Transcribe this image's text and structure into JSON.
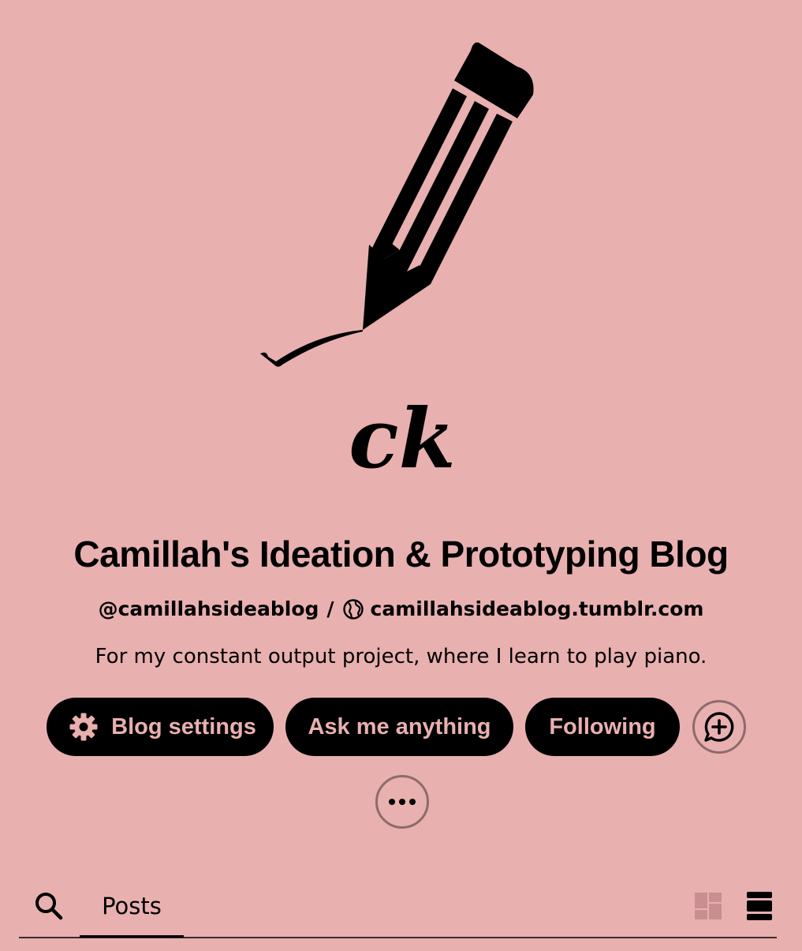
{
  "blog": {
    "title": "Camillah's Ideation & Prototyping Blog",
    "handle": "@camillahsideablog",
    "separator": "/",
    "url": "camillahsideablog.tumblr.com",
    "description": "For my constant output project, where I learn to play piano.",
    "avatar_monogram": "ck"
  },
  "actions": {
    "blog_settings_label": "Blog settings",
    "ask_label": "Ask me anything",
    "following_label": "Following"
  },
  "icons": {
    "avatar": "pencil-signature-logo",
    "globe": "globe-icon",
    "settings": "gear-icon",
    "chat": "chat-plus-icon",
    "more": "ellipsis-icon",
    "search": "search-icon",
    "grid": "grid-view-icon",
    "list": "list-view-icon"
  },
  "tabs": {
    "posts_label": "Posts"
  },
  "colors": {
    "background": "#e9b0b0",
    "pill": "#000000",
    "pill_text": "#e9b0b0",
    "circle_border": "#8e6b6b",
    "grid_icon_inactive": "#c98f90"
  }
}
